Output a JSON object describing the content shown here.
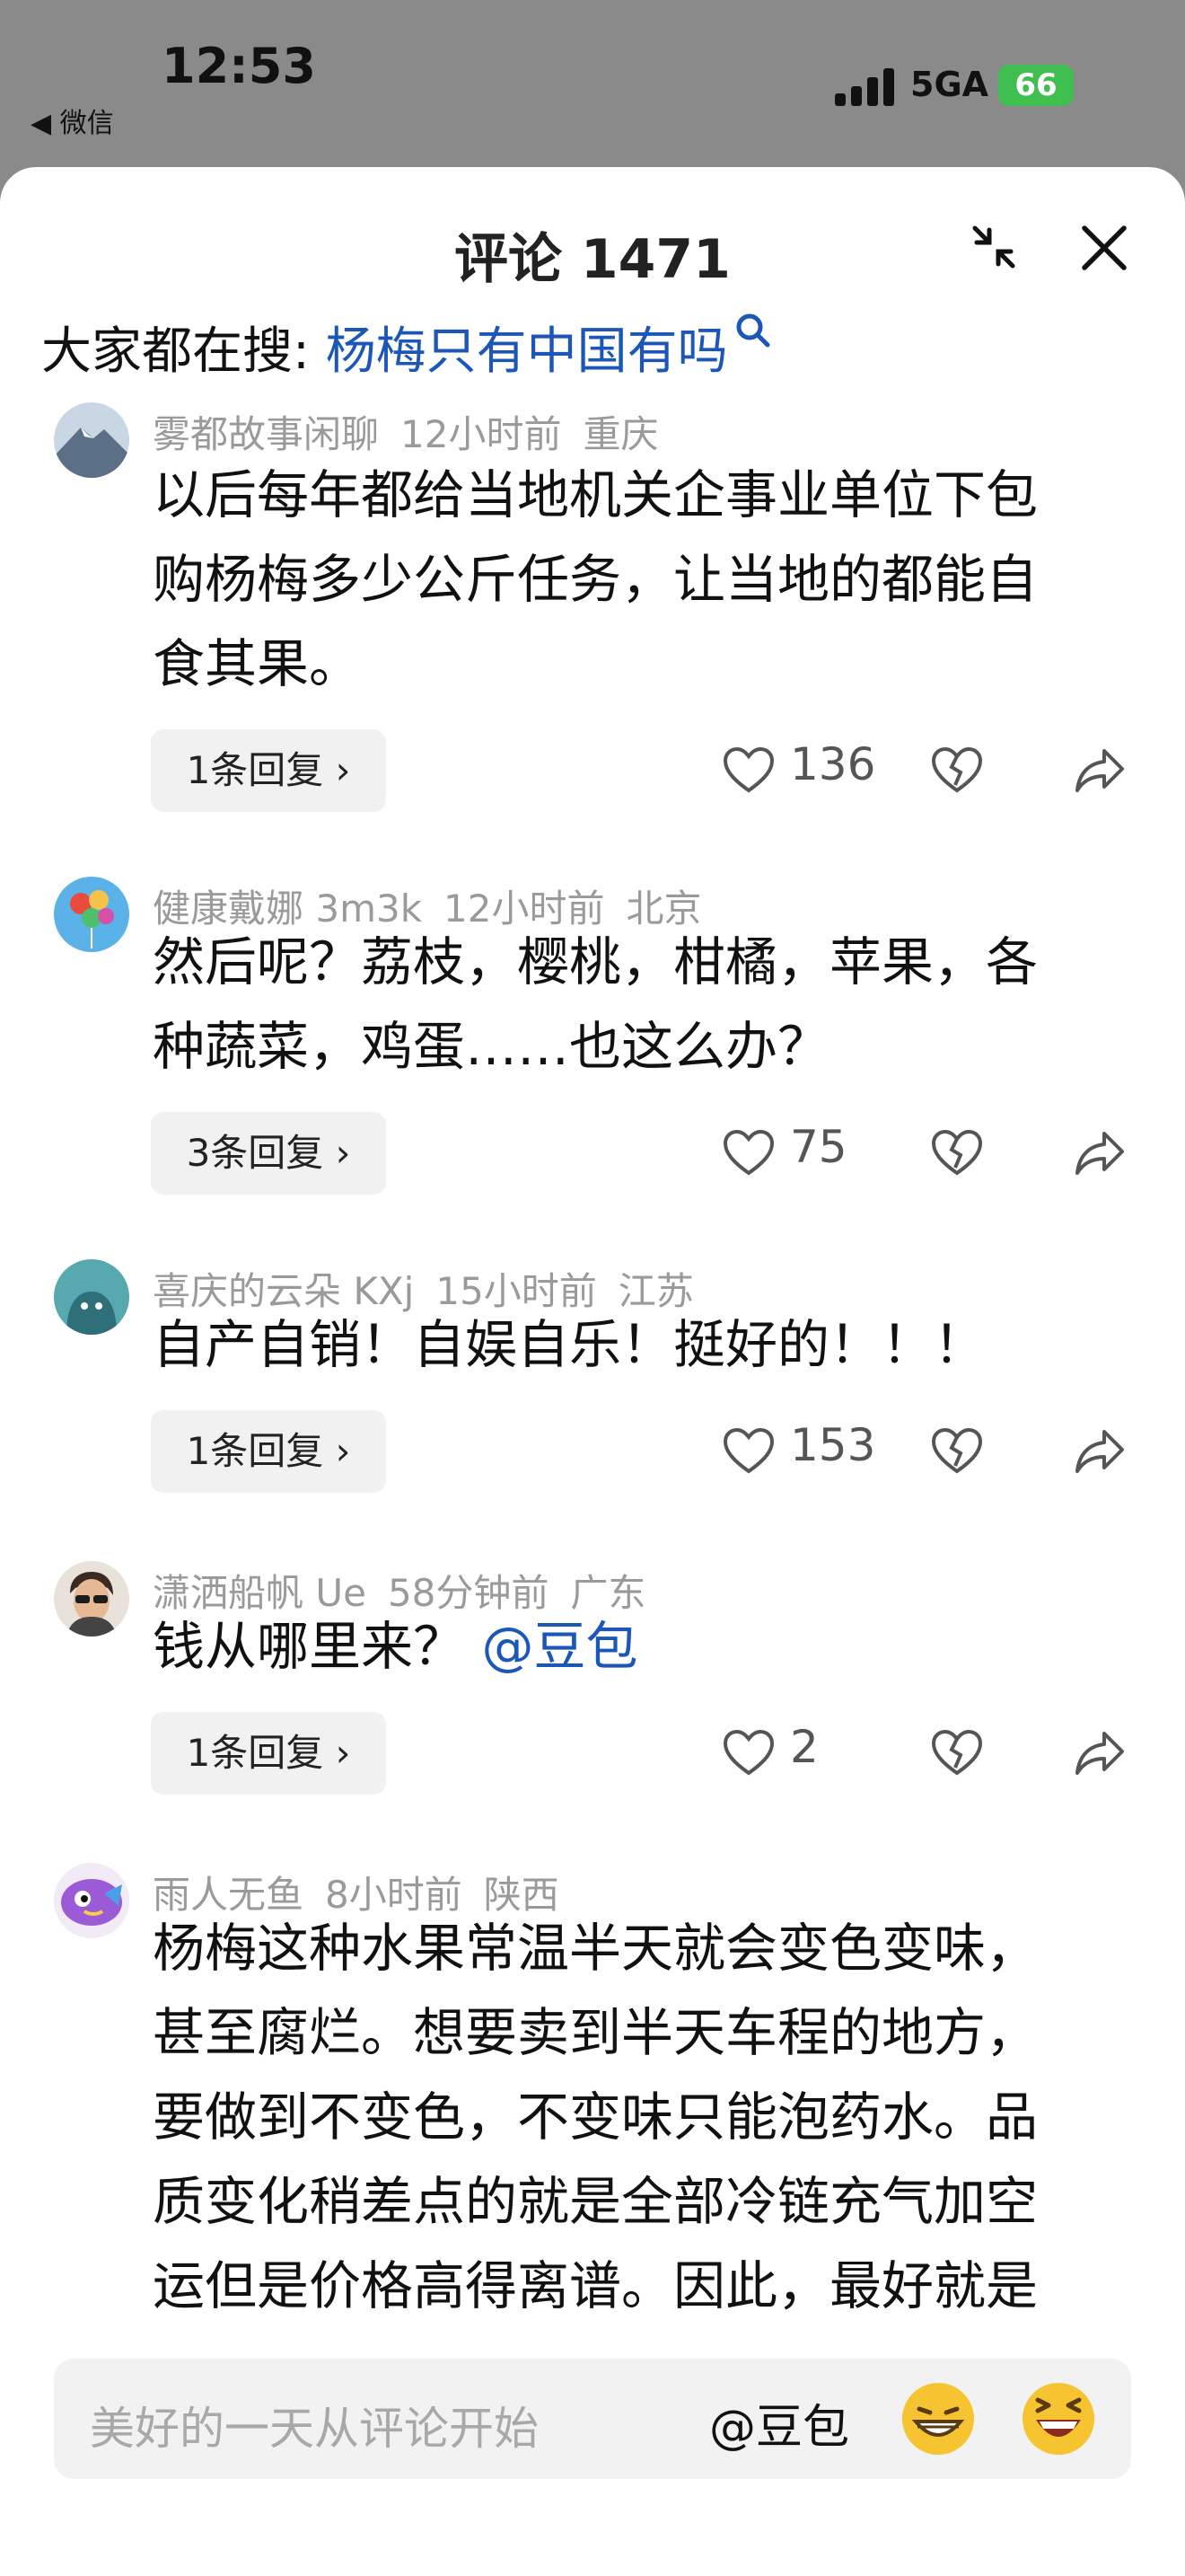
{
  "status_bar": {
    "time": "12:53",
    "back_label": "◀ 微信",
    "network": "5GA",
    "battery": "66"
  },
  "header": {
    "title": "评论 1471"
  },
  "search": {
    "prefix": "大家都在搜: ",
    "keyword": "杨梅只有中国有吗"
  },
  "comments": [
    {
      "user": "雾都故事闲聊",
      "time": "12小时前",
      "location": "重庆",
      "lines": [
        "以后每年都给当地机关企事业单位下包",
        "购杨梅多少公斤任务，让当地的都能自",
        "食其果。"
      ],
      "replies": "1条回复 ›",
      "likes": "136"
    },
    {
      "user": "健康戴娜 3m3k",
      "time": "12小时前",
      "location": "北京",
      "lines": [
        "然后呢？荔枝，樱桃，柑橘，苹果，各",
        "种蔬菜，鸡蛋……也这么办？"
      ],
      "replies": "3条回复 ›",
      "likes": "75"
    },
    {
      "user": "喜庆的云朵 KXj",
      "time": "15小时前",
      "location": "江苏",
      "lines": [
        "自产自销！自娱自乐！挺好的！！！"
      ],
      "replies": "1条回复 ›",
      "likes": "153"
    },
    {
      "user": "潇洒船帆 Ue",
      "time": "58分钟前",
      "location": "广东",
      "text": "钱从哪里来？",
      "mention": "@豆包",
      "replies": "1条回复 ›",
      "likes": "2"
    },
    {
      "user": "雨人无鱼",
      "time": "8小时前",
      "location": "陕西",
      "lines": [
        "杨梅这种水果常温半天就会变色变味，",
        "甚至腐烂。想要卖到半天车程的地方，",
        "要做到不变色，不变味只能泡药水。品",
        "质变化稍差点的就是全部冷链充气加空",
        "运但是价格高得离谱。因此，最好就是"
      ]
    }
  ],
  "input": {
    "placeholder": "美好的一天从评论开始",
    "at_label": "@豆包"
  },
  "colors": {
    "link": "#1c57b8",
    "meta": "#9a9a9a",
    "battery": "#3fbf4f"
  }
}
